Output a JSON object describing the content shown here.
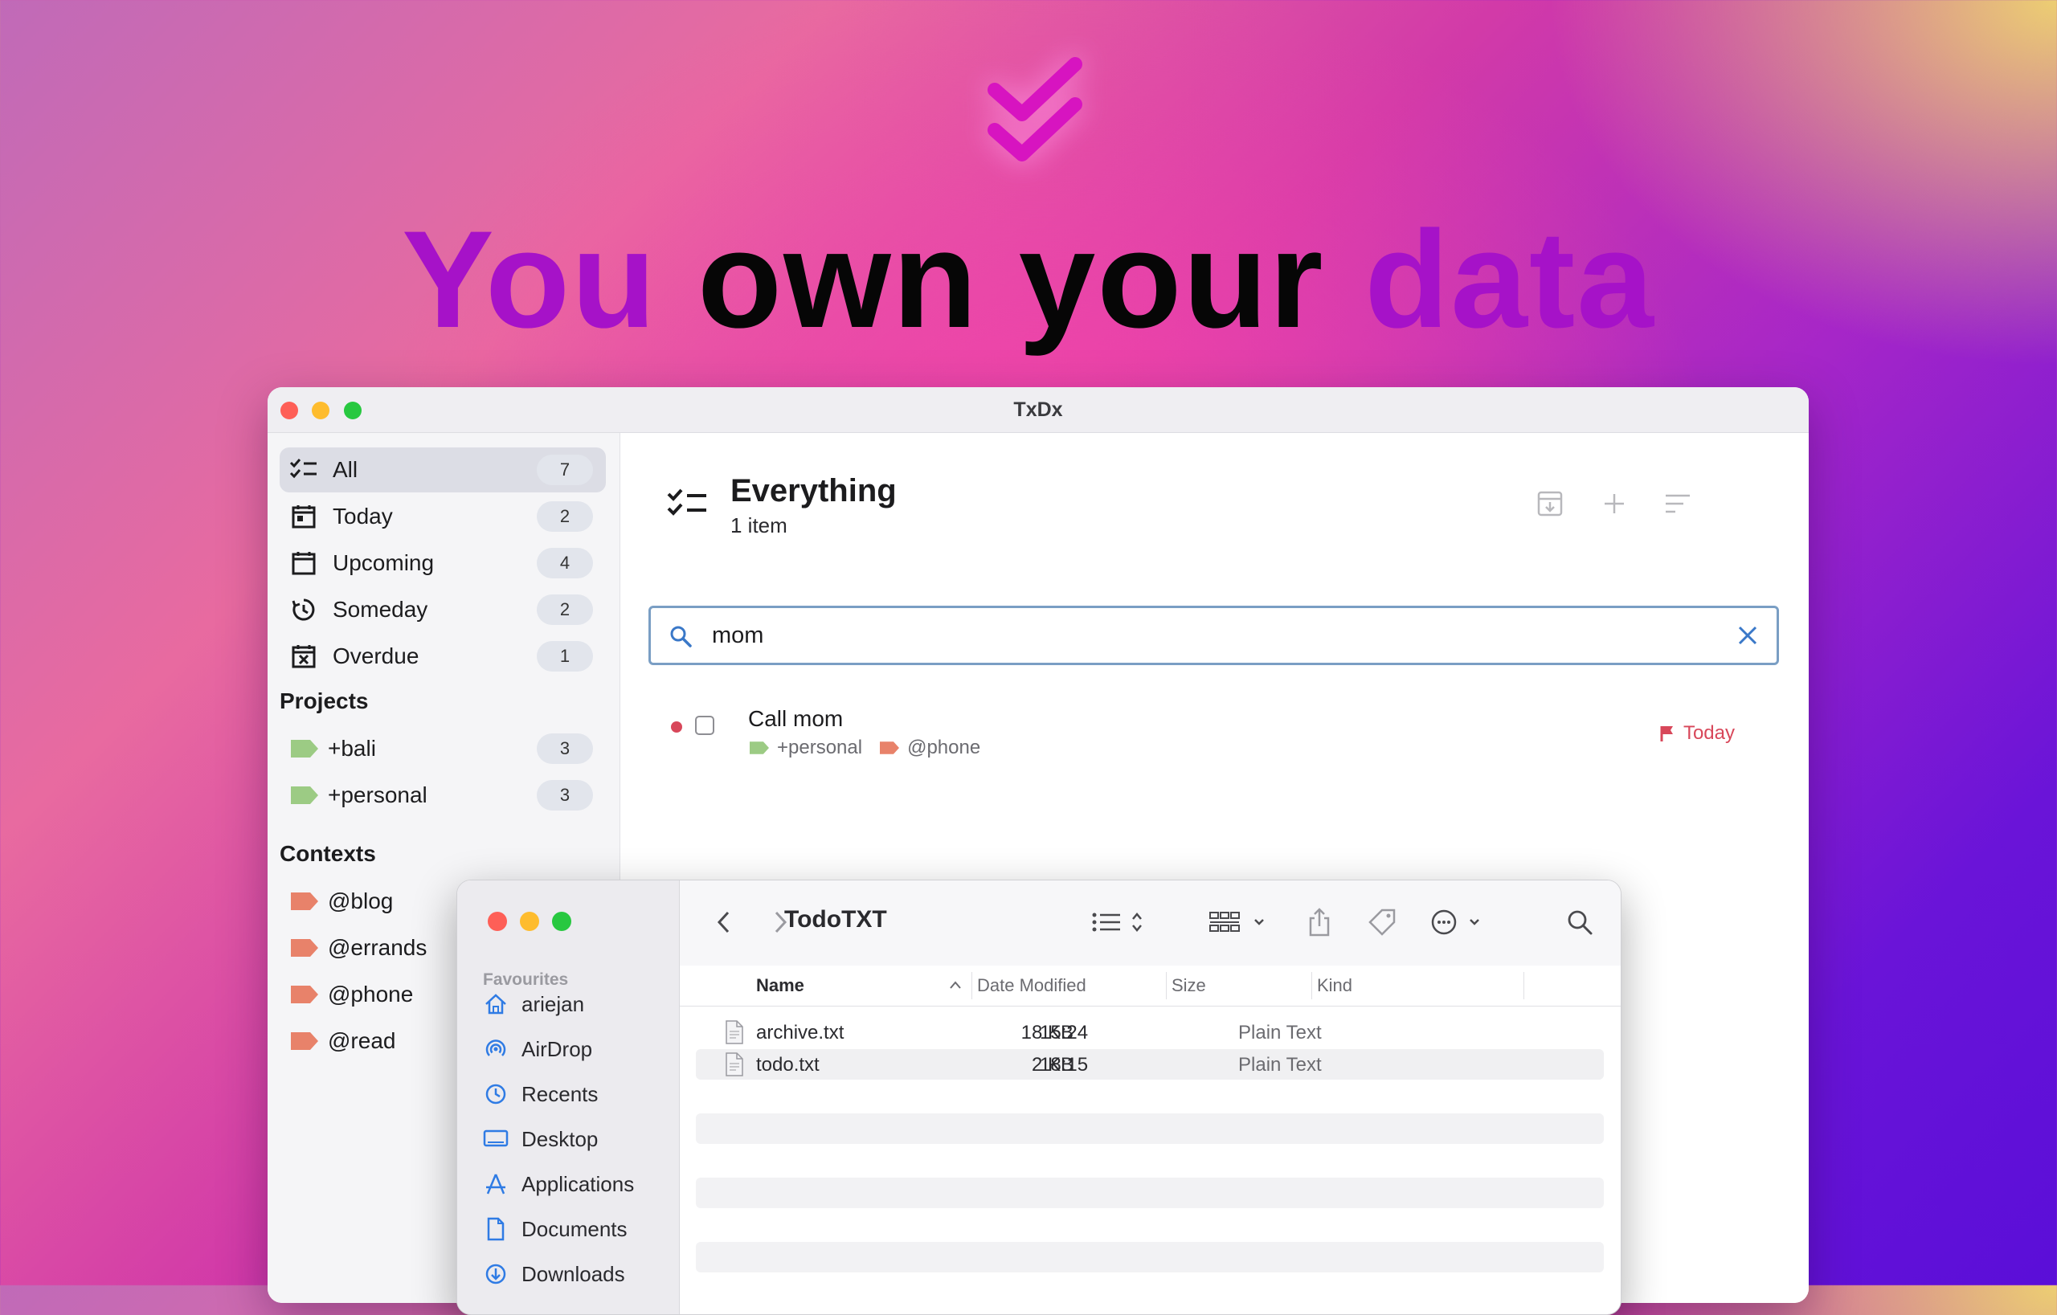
{
  "hero": {
    "word1": "You",
    "word2": "own",
    "word3": "your",
    "word4": "data"
  },
  "colors": {
    "accent": "#a612c8",
    "selection": "#dcdde5",
    "search_border": "#7a9ec4",
    "due_red": "#d8475a",
    "project_tag": "#9ccb84",
    "context_tag": "#e8826a"
  },
  "app": {
    "title": "TxDx",
    "sidebar": {
      "smart_lists": [
        {
          "label": "All",
          "count": "7",
          "icon": "checklist-icon"
        },
        {
          "label": "Today",
          "count": "2",
          "icon": "calendar-today-icon"
        },
        {
          "label": "Upcoming",
          "count": "4",
          "icon": "calendar-icon"
        },
        {
          "label": "Someday",
          "count": "2",
          "icon": "clock-arrow-icon"
        },
        {
          "label": "Overdue",
          "count": "1",
          "icon": "calendar-x-icon"
        }
      ],
      "projects_heading": "Projects",
      "projects": [
        {
          "label": "+bali",
          "count": "3"
        },
        {
          "label": "+personal",
          "count": "3"
        }
      ],
      "contexts_heading": "Contexts",
      "contexts": [
        {
          "label": "@blog"
        },
        {
          "label": "@errands"
        },
        {
          "label": "@phone"
        },
        {
          "label": "@read"
        }
      ]
    },
    "main": {
      "title": "Everything",
      "subtitle": "1 item",
      "search_value": "mom",
      "tasks": [
        {
          "title": "Call mom",
          "project": "+personal",
          "context": "@phone",
          "due": "Today"
        }
      ]
    }
  },
  "finder": {
    "location": "TodoTXT",
    "favourites_heading": "Favourites",
    "sidebar_items": [
      {
        "label": "ariejan",
        "icon": "home-icon"
      },
      {
        "label": "AirDrop",
        "icon": "airdrop-icon"
      },
      {
        "label": "Recents",
        "icon": "clock-icon"
      },
      {
        "label": "Desktop",
        "icon": "desktop-icon"
      },
      {
        "label": "Applications",
        "icon": "applications-icon"
      },
      {
        "label": "Documents",
        "icon": "document-icon"
      },
      {
        "label": "Downloads",
        "icon": "download-icon"
      }
    ],
    "columns": {
      "name": "Name",
      "date": "Date Modified",
      "size": "Size",
      "kind": "Kind"
    },
    "files": [
      {
        "name": "archive.txt",
        "date": "15:24",
        "size": "18 KB",
        "kind": "Plain Text"
      },
      {
        "name": "todo.txt",
        "date": "18:15",
        "size": "2 KB",
        "kind": "Plain Text"
      }
    ]
  }
}
